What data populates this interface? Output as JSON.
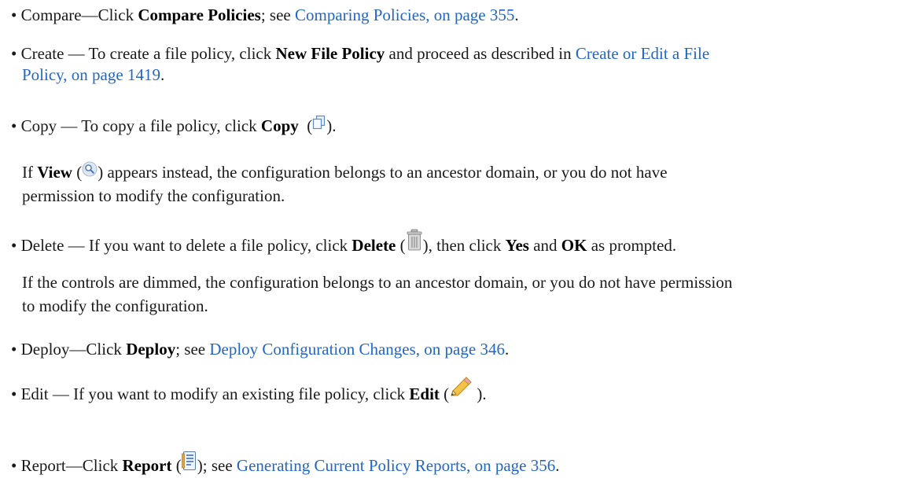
{
  "compare": {
    "bullet": "•",
    "label": "Compare—Click",
    "bold": "Compare Policies",
    "mid": "; see",
    "link": "Comparing Policies, on page 355",
    "end": "."
  },
  "create": {
    "bullet": "•",
    "label": "Create — To create a file policy, click",
    "bold": "New File Policy",
    "mid": "and proceed as described in",
    "link_line1": "Create or Edit a File",
    "link_line2": "Policy, on page 1419",
    "end": "."
  },
  "copy": {
    "bullet": "•",
    "label": "Copy — To copy a file policy, click",
    "bold": "Copy",
    "open": "(",
    "close": ").",
    "icon": "copy-icon",
    "view_pre": "If",
    "view_bold": "View",
    "view_open": "(",
    "view_icon": "magnifier-icon",
    "view_rest": ") appears instead, the configuration belongs to an ancestor domain, or you do not have",
    "view_line2": "permission to modify the configuration."
  },
  "delete": {
    "bullet": "•",
    "label": "Delete — If you want to delete a file policy, click",
    "bold": "Delete",
    "open": "(",
    "icon": "trash-icon",
    "close": "), then click",
    "yes": "Yes",
    "and": "and",
    "ok": "OK",
    "end": "as prompted.",
    "note_line1": "If the controls are dimmed, the configuration belongs to an ancestor domain, or you do not have permission",
    "note_line2": "to modify the configuration."
  },
  "deploy": {
    "bullet": "•",
    "label": "Deploy—Click",
    "bold": "Deploy",
    "mid": "; see",
    "link": "Deploy Configuration Changes, on page 346",
    "end": "."
  },
  "edit": {
    "bullet": "•",
    "label": "Edit — If you want to modify an existing file policy, click",
    "bold": "Edit",
    "open": "(",
    "icon": "pencil-icon",
    "close": ")."
  },
  "report": {
    "bullet": "•",
    "label": "Report—Click",
    "bold": "Report",
    "open": "(",
    "icon": "report-icon",
    "close": "); see",
    "link": "Generating Current Policy Reports, on page 356",
    "end": "."
  },
  "colors": {
    "link": "#2266c8",
    "text": "#1a1a1a"
  }
}
